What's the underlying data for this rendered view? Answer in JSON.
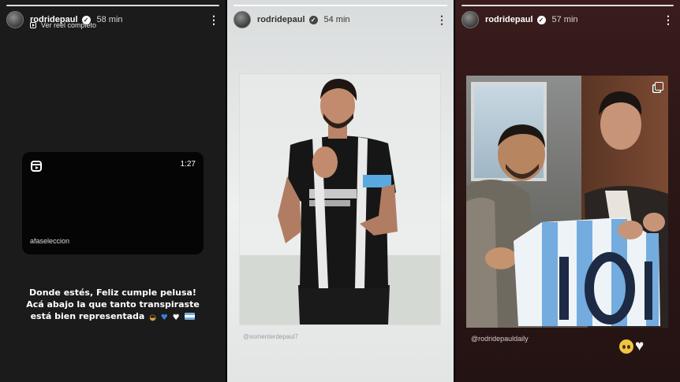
{
  "stories": [
    {
      "username": "rodridepaul",
      "time": "58 min",
      "subtitle": "Ver reel completo",
      "reel": {
        "duration": "1:27",
        "account": "afaseleccion"
      },
      "caption_lines": [
        "Donde estés, Feliz cumple pelusa!",
        "Acá abajo la que tanto transpiraste",
        "está bien representada"
      ]
    },
    {
      "username": "rodridepaul",
      "time": "54 min",
      "photo_tag": "@somenterdepaul7"
    },
    {
      "username": "rodridepaul",
      "time": "57 min",
      "photo_tag": "@rodridepauldaily"
    }
  ],
  "icons": [
    "verified-badge-icon",
    "more-options-icon",
    "reel-icon",
    "multi-photo-icon",
    "argentina-flag-emoji",
    "pleading-face-emoji",
    "white-heart-emoji"
  ],
  "colors": {
    "argentina_blue": "#74acdf"
  }
}
